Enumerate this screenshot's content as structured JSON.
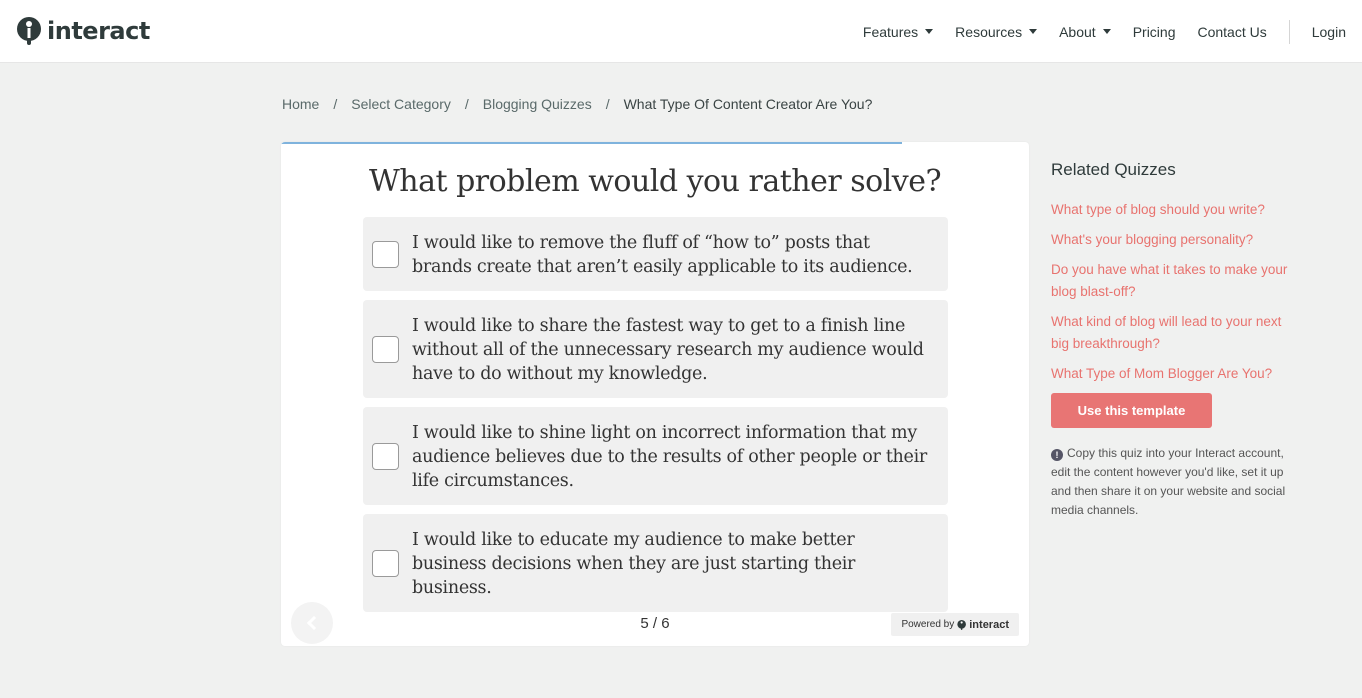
{
  "header": {
    "logo_text": "interact",
    "nav": [
      {
        "label": "Features",
        "has_caret": true
      },
      {
        "label": "Resources",
        "has_caret": true
      },
      {
        "label": "About",
        "has_caret": true
      },
      {
        "label": "Pricing",
        "has_caret": false
      },
      {
        "label": "Contact Us",
        "has_caret": false
      }
    ],
    "login_label": "Login"
  },
  "breadcrumb": {
    "home": "Home",
    "category": "Select Category",
    "subcategory": "Blogging Quizzes",
    "current": "What Type Of Content Creator Are You?",
    "separator": "/"
  },
  "quiz": {
    "progress": 0.83,
    "question": "What problem would you rather solve?",
    "answers": [
      {
        "text": "I would like to remove the fluff of “how to” posts that brands create that aren’t easily applicable to its audience."
      },
      {
        "text": "I would like to share the fastest way to get to a finish line without all of the unnecessary research my audience would have to do without my knowledge."
      },
      {
        "text": "I would like to shine light on incorrect information that my audience believes due to the results of other people or their life circumstances."
      },
      {
        "text": "I would like to educate my audience to make better business decisions when they are just starting their business."
      }
    ],
    "page_counter": "5 / 6",
    "powered_by_label": "Powered by",
    "powered_by_brand": "interact"
  },
  "sidebar": {
    "title": "Related Quizzes",
    "related": [
      "What type of blog should you write?",
      "What's your blogging personality?",
      "Do you have what it takes to make your blog blast-off?",
      "What kind of blog will lead to your next big breakthrough?",
      "What Type of Mom Blogger Are You?"
    ],
    "cta_label": "Use this template",
    "info_text": "Copy this quiz into your Interact account, edit the content however you'd like, set it up and then share it on your website and social media channels."
  },
  "colors": {
    "accent": "#e87574",
    "link": "#e8736f",
    "progress": "#7fb3dd",
    "background": "#f0f1f0"
  }
}
